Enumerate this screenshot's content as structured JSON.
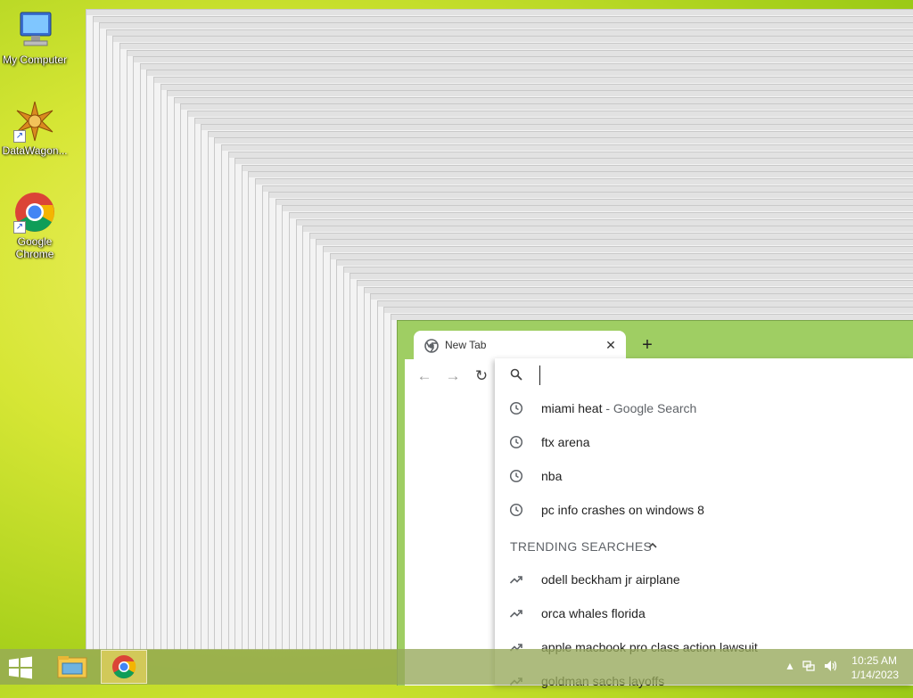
{
  "desktop": {
    "icons": [
      {
        "label": "My Computer"
      },
      {
        "label": "DataWagon..."
      },
      {
        "label": "Google Chrome"
      }
    ]
  },
  "chrome": {
    "tab_title": "New Tab",
    "omnibox": {
      "placeholder": "",
      "suggestions": [
        {
          "text": "miami heat",
          "sub": " - Google Search",
          "icon": "history-icon"
        },
        {
          "text": "ftx arena",
          "sub": "",
          "icon": "history-icon"
        },
        {
          "text": "nba",
          "sub": "",
          "icon": "history-icon"
        },
        {
          "text": "pc info crashes on windows 8",
          "sub": "",
          "icon": "history-icon"
        }
      ],
      "trending_header": "TRENDING SEARCHES",
      "trending": [
        {
          "text": "odell beckham jr airplane",
          "icon": "trending-icon"
        },
        {
          "text": "orca whales florida",
          "icon": "trending-icon"
        },
        {
          "text": "apple macbook pro class action lawsuit",
          "icon": "trending-icon"
        },
        {
          "text": "goldman sachs layoffs",
          "icon": "trending-icon"
        }
      ]
    }
  },
  "taskbar": {
    "time": "10:25 AM",
    "date": "1/14/2023"
  },
  "colors": {
    "chrome_frame": "#9fce63",
    "desktop_accent": "#d6e635"
  }
}
